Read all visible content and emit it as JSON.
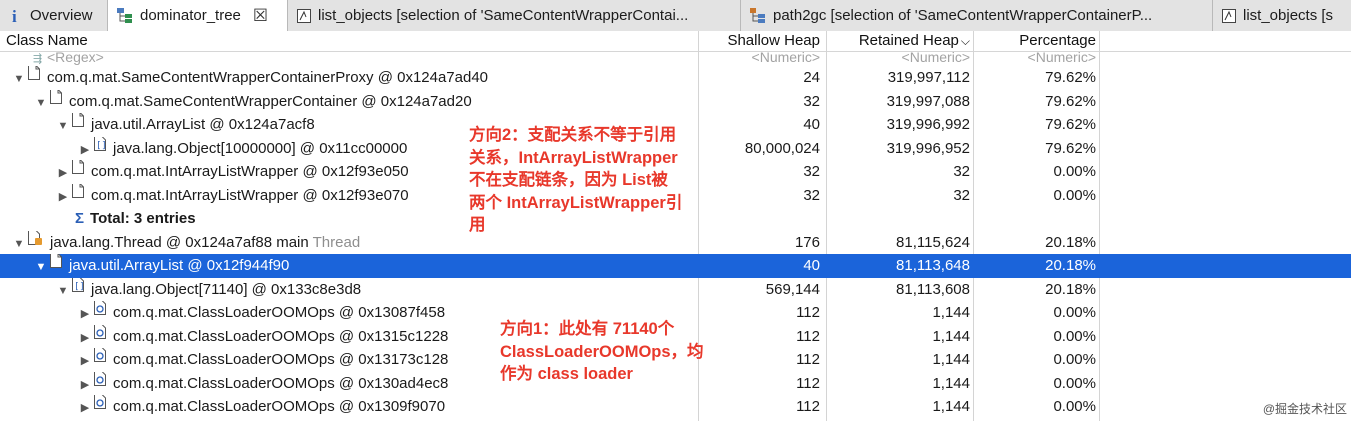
{
  "tabs": [
    {
      "label": "Overview",
      "icon": "info-icon",
      "active": false
    },
    {
      "label": "dominator_tree",
      "icon": "dominator-tree-icon",
      "active": true,
      "close": "☒"
    },
    {
      "label": "list_objects  [selection of 'SameContentWrapperContai...",
      "icon": "list-objects-icon",
      "active": false
    },
    {
      "label": "path2gc  [selection of 'SameContentWrapperContainerP...",
      "icon": "path2gc-icon",
      "active": false
    },
    {
      "label": "list_objects  [s",
      "icon": "list-objects-icon",
      "active": false
    }
  ],
  "columns": {
    "class_name": "Class Name",
    "shallow_heap": "Shallow Heap",
    "retained_heap": "Retained Heap",
    "retained_sort": "⌵",
    "percentage": "Percentage"
  },
  "filter_row": {
    "class_name": "<Regex>",
    "shallow_heap": "<Numeric>",
    "retained_heap": "<Numeric>",
    "percentage": "<Numeric>"
  },
  "rows": [
    {
      "name": "com.q.mat.SameContentWrapperContainerProxy @ 0x124a7ad40",
      "shallow": "24",
      "retained": "319,997,112",
      "pct": "79.62%",
      "toggle": "▼",
      "icon": "object-icon"
    },
    {
      "name": "com.q.mat.SameContentWrapperContainer @ 0x124a7ad20",
      "shallow": "32",
      "retained": "319,997,088",
      "pct": "79.62%",
      "toggle": "▼",
      "icon": "object-icon"
    },
    {
      "name": "java.util.ArrayList @ 0x124a7acf8",
      "shallow": "40",
      "retained": "319,996,992",
      "pct": "79.62%",
      "toggle": "▼",
      "icon": "object-icon"
    },
    {
      "name": "java.lang.Object[10000000] @ 0x11cc00000",
      "shallow": "80,000,024",
      "retained": "319,996,952",
      "pct": "79.62%",
      "toggle": "▶",
      "icon": "array-icon"
    },
    {
      "name": "com.q.mat.IntArrayListWrapper @ 0x12f93e050",
      "shallow": "32",
      "retained": "32",
      "pct": "0.00%",
      "toggle": "▶",
      "icon": "object-icon"
    },
    {
      "name": "com.q.mat.IntArrayListWrapper @ 0x12f93e070",
      "shallow": "32",
      "retained": "32",
      "pct": "0.00%",
      "toggle": "▶",
      "icon": "object-icon"
    },
    {
      "name": "Total: 3 entries",
      "shallow": "",
      "retained": "",
      "pct": "",
      "toggle": "",
      "icon": "sigma-icon",
      "total_symbol": "Σ"
    },
    {
      "name": "java.lang.Thread @ 0x124a7af88  main",
      "thread_word": "Thread",
      "shallow": "176",
      "retained": "81,115,624",
      "pct": "20.18%",
      "toggle": "▼",
      "icon": "thread-icon"
    },
    {
      "name": "java.util.ArrayList @ 0x12f944f90",
      "shallow": "40",
      "retained": "81,113,648",
      "pct": "20.18%",
      "toggle": "▼",
      "icon": "object-icon",
      "selected": true
    },
    {
      "name": "java.lang.Object[71140] @ 0x133c8e3d8",
      "shallow": "569,144",
      "retained": "81,113,608",
      "pct": "20.18%",
      "toggle": "▼",
      "icon": "array-icon"
    },
    {
      "name": "com.q.mat.ClassLoaderOOMOps @ 0x13087f458",
      "shallow": "112",
      "retained": "1,144",
      "pct": "0.00%",
      "toggle": "▶",
      "icon": "classloader-icon"
    },
    {
      "name": "com.q.mat.ClassLoaderOOMOps @ 0x1315c1228",
      "shallow": "112",
      "retained": "1,144",
      "pct": "0.00%",
      "toggle": "▶",
      "icon": "classloader-icon"
    },
    {
      "name": "com.q.mat.ClassLoaderOOMOps @ 0x13173c128",
      "shallow": "112",
      "retained": "1,144",
      "pct": "0.00%",
      "toggle": "▶",
      "icon": "classloader-icon"
    },
    {
      "name": "com.q.mat.ClassLoaderOOMOps @ 0x130ad4ec8",
      "shallow": "112",
      "retained": "1,144",
      "pct": "0.00%",
      "toggle": "▶",
      "icon": "classloader-icon"
    },
    {
      "name": "com.q.mat.ClassLoaderOOMOps @ 0x1309f9070",
      "shallow": "112",
      "retained": "1,144",
      "pct": "0.00%",
      "toggle": "▶",
      "icon": "classloader-icon"
    }
  ],
  "annotations": {
    "direction2": "方向2：支配关系不等于引用\n关系，IntArrayListWrapper\n不在支配链条，因为 List被\n两个 IntArrayListWrapper引\n用",
    "direction1": "方向1：此处有 71140个\nClassLoaderOOMOps，均\n作为 class loader"
  },
  "watermark": "@掘金技术社区",
  "colors": {
    "selection": "#1b64da",
    "annotation": "#e8382b",
    "tabbar": "#e3e3e3"
  }
}
